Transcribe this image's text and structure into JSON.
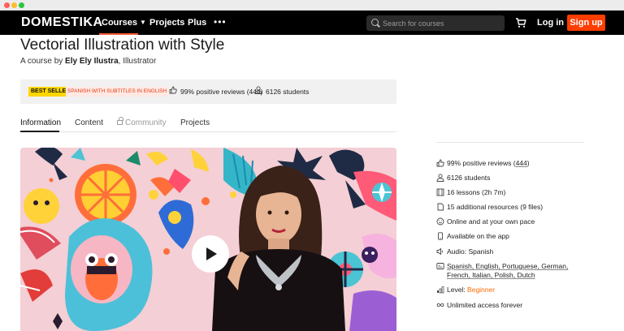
{
  "nav": {
    "logo": "DOMESTIKA",
    "courses": "Courses",
    "projects": "Projects",
    "plus": "Plus",
    "more": "•••",
    "search_placeholder": "Search for courses",
    "login": "Log in",
    "signup": "Sign up"
  },
  "course": {
    "title": "Vectorial Illustration with Style",
    "byline_prefix": "A course by",
    "author": "Ely Ely Ilustra",
    "author_role": ", Illustrator"
  },
  "infobar": {
    "best_seller": "BEST SELLER",
    "language_badge": "SPANISH WITH SUBTITLES IN ENGLISH",
    "reviews": "99% positive reviews (444)",
    "students": "6126 students"
  },
  "tabs": {
    "information": "Information",
    "content": "Content",
    "community": "Community",
    "projects": "Projects"
  },
  "features": {
    "reviews_prefix": "99% positive reviews (",
    "reviews_count": "444",
    "reviews_suffix": ")",
    "students": "6126 students",
    "lessons": "16 lessons (2h 7m)",
    "resources": "15 additional resources (9 files)",
    "online": "Online and at your own pace",
    "app": "Available on the app",
    "audio": "Audio: Spanish",
    "subtitles": "Spanish, English, Portuguese, German, French, Italian, Polish, Dutch",
    "level_prefix": "Level: ",
    "level": "Beginner",
    "access": "Unlimited access forever"
  },
  "colors": {
    "accent": "#ff3d00",
    "best_seller": "#ffd600",
    "level": "#ff6a00"
  }
}
